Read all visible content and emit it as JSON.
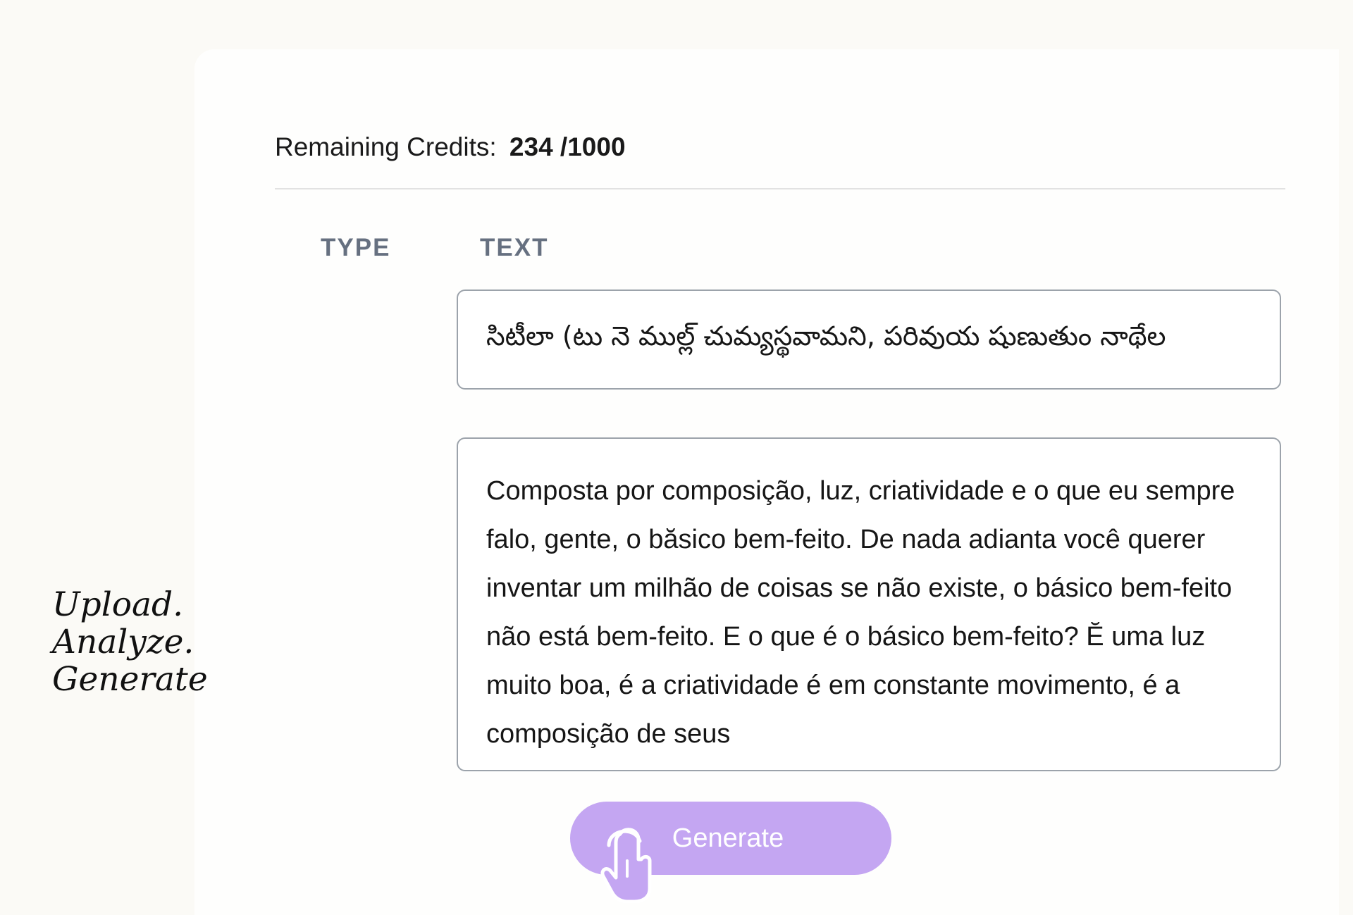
{
  "credits": {
    "label": "Remaining Credits:",
    "value": "234 /1000"
  },
  "table": {
    "headers": {
      "type": "TYPE",
      "text": "TEXT"
    }
  },
  "fields": {
    "telugu_text": "సిటీలా (టు నె ముల్ల్ చుమ్యస్థవామని, పరివుయ షుణుతుం నాథేల",
    "portuguese_text": "Composta por composição, luz, criatividade e o que eu sempre falo, gente, o băsico bem-feito. De nada adianta você querer inventar um milhão de coisas se não existe, o básico bem-feito não está bem-feito. E o que é o básico bem-feito? Ĕ uma luz muito boa, é a criatividade é em constante movimento, é a composição de seus"
  },
  "generate_button": {
    "label": "Generate",
    "color": "#c4a6f2"
  },
  "tagline": {
    "line1": "Upload.",
    "line2": "Analyze.",
    "line3": "Generate"
  },
  "icons": {
    "cursor": "hand-pointer-icon"
  }
}
